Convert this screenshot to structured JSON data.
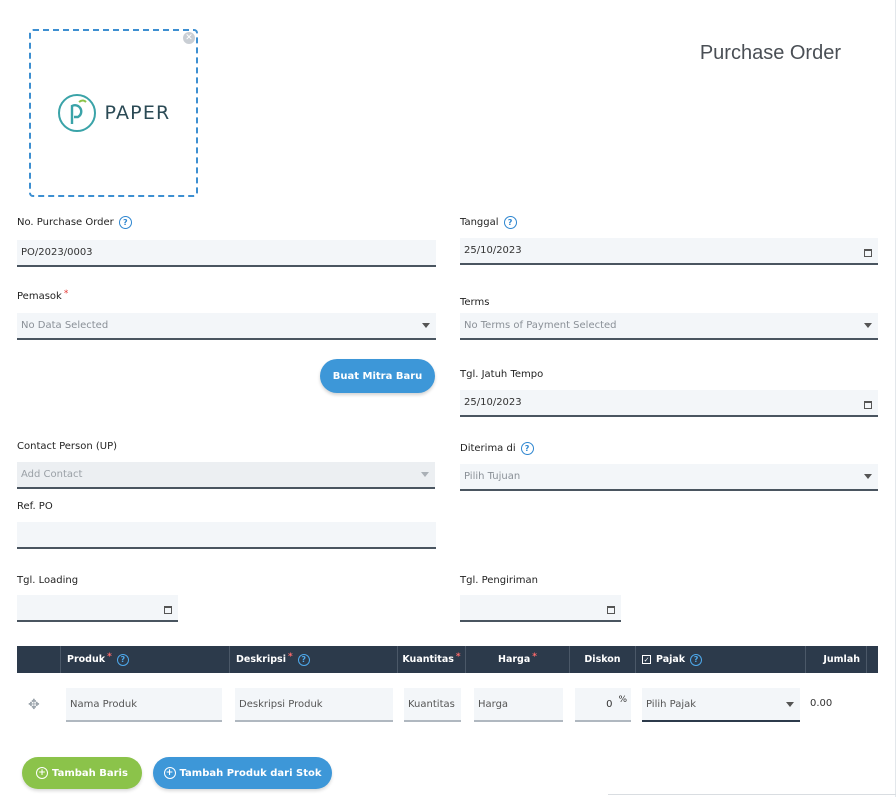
{
  "header": {
    "doc_title": "Purchase Order",
    "logo_text": "PAPER",
    "logo_close_icon": "close-icon"
  },
  "form": {
    "po_number": {
      "label": "No. Purchase Order",
      "value": "PO/2023/0003"
    },
    "date": {
      "label": "Tanggal",
      "value": "25/10/2023"
    },
    "supplier": {
      "label": "Pemasok",
      "required": "*",
      "placeholder": "No Data Selected"
    },
    "terms": {
      "label": "Terms",
      "placeholder": "No Terms of Payment Selected"
    },
    "new_partner_button": "Buat Mitra Baru",
    "due_date": {
      "label": "Tgl. Jatuh Tempo",
      "value": "25/10/2023"
    },
    "contact": {
      "label": "Contact Person (UP)",
      "placeholder": "Add Contact"
    },
    "received_at": {
      "label": "Diterima di",
      "placeholder": "Pilih Tujuan"
    },
    "ref_po": {
      "label": "Ref. PO",
      "value": ""
    },
    "loading_date": {
      "label": "Tgl. Loading",
      "value": ""
    },
    "delivery_date": {
      "label": "Tgl. Pengiriman",
      "value": ""
    }
  },
  "table": {
    "headers": {
      "product": "Produk",
      "description": "Deskripsi",
      "quantity": "Kuantitas",
      "price": "Harga",
      "discount": "Diskon",
      "tax": "Pajak",
      "amount": "Jumlah",
      "required": "*"
    },
    "row": {
      "product_placeholder": "Nama Produk",
      "description_placeholder": "Deskripsi Produk",
      "quantity_placeholder": "Kuantitas",
      "price_placeholder": "Harga",
      "discount_value": "0",
      "discount_unit": "%",
      "tax_placeholder": "Pilih Pajak",
      "amount": "0.00"
    }
  },
  "actions": {
    "add_row": "Tambah Baris",
    "add_from_stock": "Tambah Produk dari Stok"
  },
  "colors": {
    "accent": "#3d97d8",
    "green": "#8bc34a",
    "table_header": "#2c3a4b",
    "required": "#e53935"
  }
}
